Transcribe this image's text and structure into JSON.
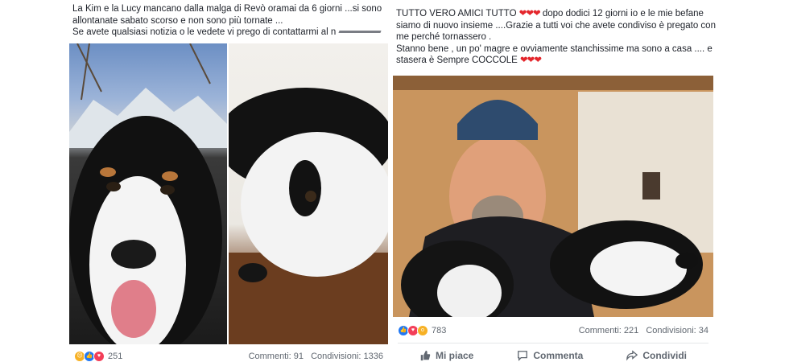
{
  "left_post": {
    "text_line1": "La Kim e la Lucy mancano dalla malga di Revò oramai da 6 giorni ...si sono",
    "text_line2": "allontanate sabato scorso e non sono più tornate ...",
    "text_line3": "Se avete qualsiasi notizia o le vedete vi prego di contattarmi al n",
    "reactions_count": "251",
    "comments": "Commenti: 91",
    "shares": "Condivisioni: 1336"
  },
  "right_post": {
    "text_line1_a": "TUTTO VERO AMICI TUTTO",
    "text_line1_b": "dopo dodici 12 giorni io e le mie befane",
    "text_line2": "siamo di nuovo insieme ....Grazie a tutti voi che avete condiviso è pregato con",
    "text_line3": "me perché tornassero .",
    "text_line4": "Stanno bene , un po' magre e ovviamente stanchissime ma sono a casa .... e",
    "text_line5_a": "stasera è Sempre COCCOLE",
    "hearts": "❤❤❤",
    "reactions_count": "783",
    "comments": "Commenti: 221",
    "shares": "Condivisioni: 34",
    "actions": {
      "like": "Mi piace",
      "comment": "Commenta",
      "share": "Condividi"
    }
  }
}
